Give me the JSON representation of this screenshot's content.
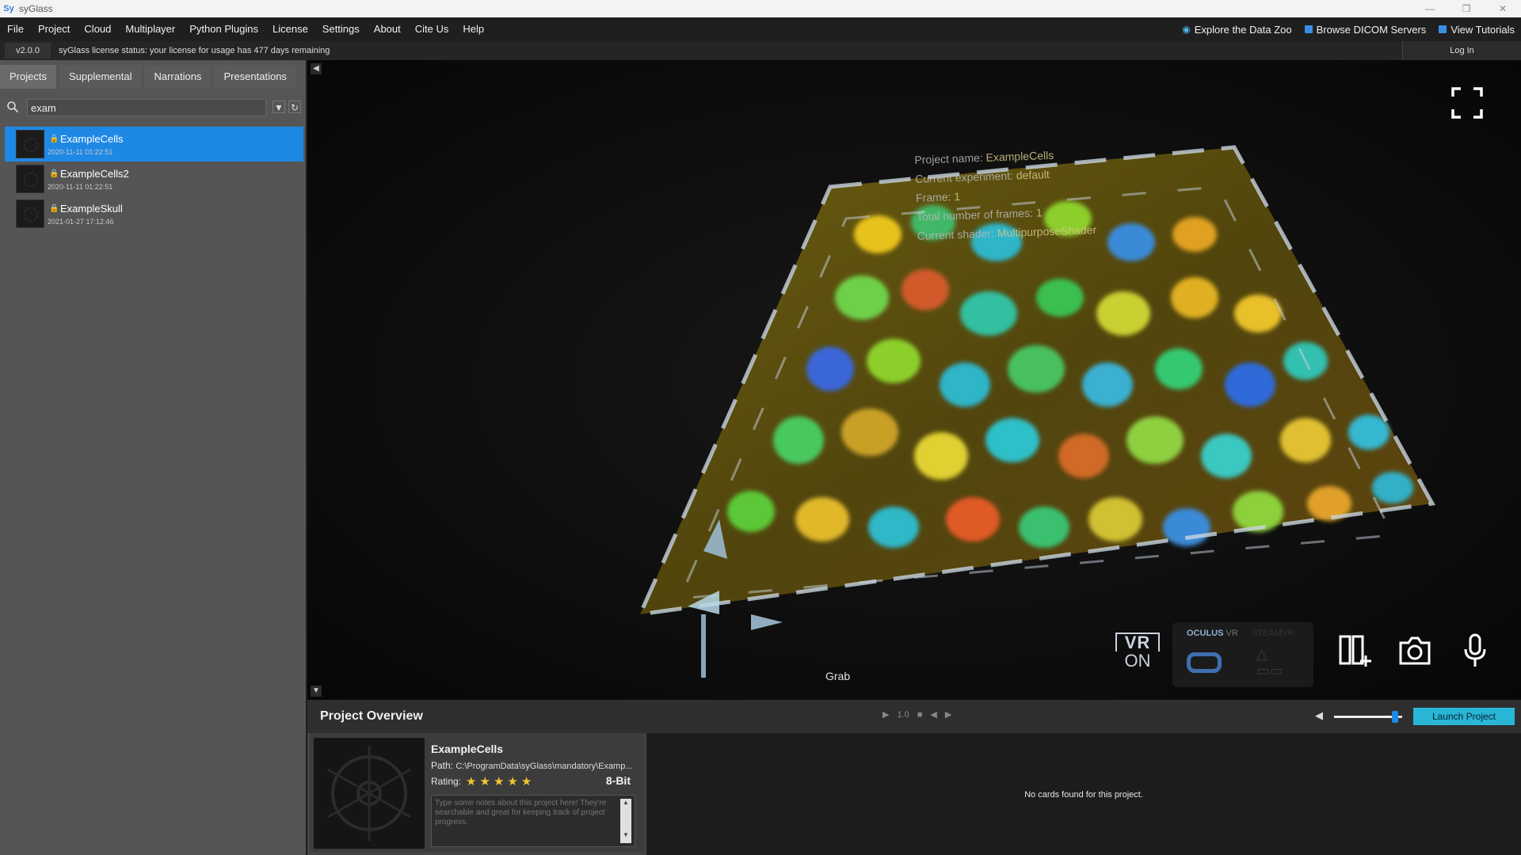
{
  "window": {
    "title": "syGlass",
    "app_icon": "syglass-logo-icon",
    "controls": [
      "minimize",
      "restore",
      "close"
    ]
  },
  "menu": {
    "items": [
      "File",
      "Project",
      "Cloud",
      "Multiplayer",
      "Python Plugins",
      "License",
      "Settings",
      "About",
      "Cite Us",
      "Help"
    ],
    "right_links": [
      {
        "label": "Explore the Data Zoo",
        "icon": "eye-icon"
      },
      {
        "label": "Browse DICOM Servers",
        "icon": "dicom-icon"
      },
      {
        "label": "View Tutorials",
        "icon": "tutorial-icon"
      }
    ]
  },
  "status": {
    "version": "v2.0.0",
    "license_text": "syGlass license status: your license for usage has 477 days remaining",
    "login_label": "Log In"
  },
  "sidebar": {
    "tabs": [
      "Projects",
      "Supplemental",
      "Narrations",
      "Presentations"
    ],
    "active_tab": "Projects",
    "search_value": "exam",
    "projects": [
      {
        "name": "ExampleCells",
        "date": "2020-11-11 01:22:51",
        "selected": true
      },
      {
        "name": "ExampleCells2",
        "date": "2020-11-11 01:22:51",
        "selected": false
      },
      {
        "name": "ExampleSkull",
        "date": "2021-01-27 17:12:46",
        "selected": false
      }
    ]
  },
  "viewport": {
    "info": {
      "project_name_label": "Project name:",
      "project_name": "ExampleCells",
      "experiment_label": "Current experiment:",
      "experiment": "default",
      "frame_label": "Frame:",
      "frame": "1",
      "total_frames_label": "Total number of frames:",
      "total_frames": "1",
      "shader_label": "Current shader:",
      "shader": "MultipurposeShader"
    },
    "grab_label": "Grab",
    "vr_label": "VR",
    "vr_state": "ON",
    "oculus_label": "OCULUS",
    "oculus_suffix": "VR",
    "steam_label": "STEAMVR"
  },
  "bottom": {
    "title": "Project Overview",
    "playback_speed": "1.0",
    "volume_percent": 90,
    "launch_label": "Launch Project",
    "overview": {
      "name": "ExampleCells",
      "path_label": "Path:",
      "path": "C:\\ProgramData\\syGlass\\mandatory\\Examp...",
      "rating_label": "Rating:",
      "rating": 5,
      "bit_depth": "8-Bit",
      "notes_placeholder": "Type some notes about this project here! They're searchable and great for keeping track of project progress."
    },
    "cards_message": "No cards found for this project."
  },
  "colors": {
    "accent": "#1e88e5",
    "launch": "#29b6d6",
    "star": "#f2c531"
  }
}
